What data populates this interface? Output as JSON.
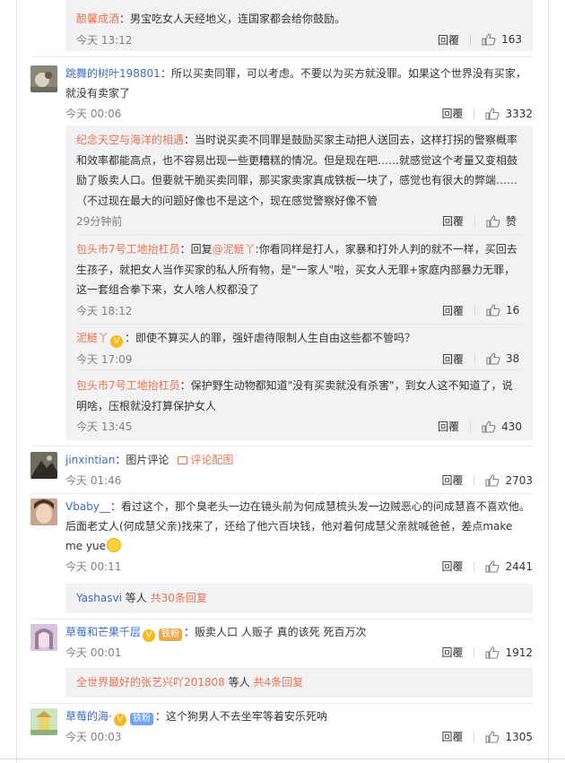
{
  "colors": {
    "accent": "#eb7350",
    "link": "#3f6bc4",
    "panel": "#f2f2f5"
  },
  "reply_label": "回覆",
  "comments": [
    {
      "sub_replies": [
        {
          "name": "酿馨成酒",
          "text": "：男宝吃女人天经地义，连国家都会给你鼓励。",
          "time": "今天 13:12",
          "likes": "163"
        }
      ]
    },
    {
      "name": "跳舞的树叶198801",
      "text": "：所以买卖同罪，可以考虑。不要以为买方就没罪。如果这个世界没有买家，就没有卖家了",
      "time": "今天 00:06",
      "likes": "3332",
      "sub_replies": [
        {
          "name": "纪念天空与海洋的相遇",
          "text": "：当时说买卖不同罪是鼓励买家主动把人送回去，这样打拐的警察概率和效率都能高点，也不容易出现一些更糟糕的情况。但是现在吧……就感觉这个考量又变相鼓励了贩卖人口。但要就干脆买卖同罪，那买家卖家真成铁板一块了，感觉也有很大的弊端……（不过现在最大的问题好像也不是这个，现在感觉警察好像不管",
          "time": "29分钟前",
          "likes": "赞"
        },
        {
          "name": "包头市7号工地抬杠员",
          "text_prefix": "：回复",
          "mention": "@泥鲢丫",
          "text": ":你看同样是打人，家暴和打外人判的就不一样，买回去生孩子，就把女人当作买家的私人所有物，是\"一家人\"啦，买女人无罪+家庭内部暴力无罪，这一套组合拳下来，女人啥人权都没了",
          "time": "今天 18:12",
          "likes": "16"
        },
        {
          "name": "泥鲢丫",
          "badge": "V",
          "text": "：即使不算买人的罪，强奸虐待限制人生自由这些都不管吗？",
          "time": "今天 17:09",
          "likes": "38"
        },
        {
          "name": "包头市7号工地抬杠员",
          "text": "：保护野生动物都知道\"没有买卖就没有杀害\"，到女人这不知道了，说明啥，压根就没打算保护女人",
          "time": "今天 13:45",
          "likes": "430"
        }
      ]
    },
    {
      "name": "jinxintian",
      "text": "：图片评论",
      "extra": "评论配图",
      "time": "今天 01:46",
      "likes": "2703"
    },
    {
      "name": "Vbaby__",
      "text": "：看过这个，那个臭老头一边在镜头前为何成慧梳头发一边贼恶心的问成慧喜不喜欢他。后面老丈人(何成慧父亲)找来了，还给了他六百块钱，他对着何成慧父亲就喊爸爸，差点make me yue",
      "time": "今天 00:11",
      "likes": "2441",
      "more": {
        "who": "Yashasvi",
        "mid": " 等人 ",
        "count": "共30条回复"
      }
    },
    {
      "name": "草莓和芒果千层",
      "badge": "V",
      "fan": "铁粉",
      "text": "：贩卖人口 人贩子 真的该死 死百万次",
      "time": "今天 00:01",
      "likes": "1912",
      "more": {
        "who": "全世界最好的张艺兴吖201808",
        "mid": " 等人 ",
        "count": "共4条回复"
      }
    },
    {
      "name": "草莓的海·",
      "badge": "V",
      "fan": "铁粉",
      "text": "：这个狗男人不去坐牢等着安乐死呐",
      "time": "今天 00:03",
      "likes": "1305"
    }
  ]
}
